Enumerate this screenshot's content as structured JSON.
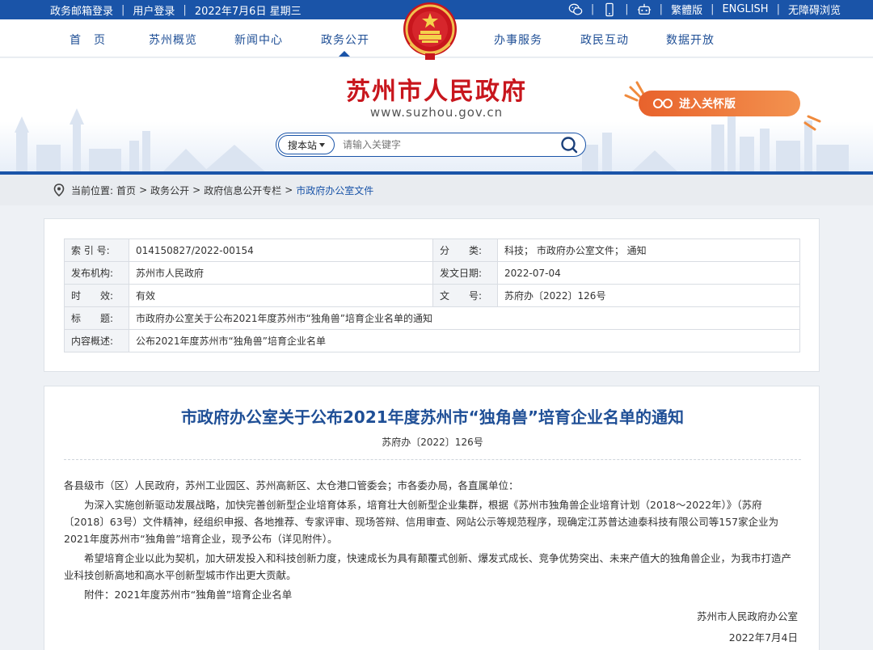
{
  "topbar": {
    "links": [
      "政务邮箱登录",
      "用户登录"
    ],
    "date": "2022年7月6日 星期三",
    "right_links": [
      "繁體版",
      "ENGLISH",
      "无障碍浏览"
    ],
    "icons": [
      "wechat-icon",
      "mobile-icon",
      "robot-icon"
    ]
  },
  "nav": {
    "items": [
      "首　页",
      "苏州概览",
      "新闻中心",
      "政务公开",
      "办事服务",
      "政民互动",
      "数据开放"
    ],
    "active": "政务公开"
  },
  "header": {
    "title": "苏州市人民政府",
    "url": "www.suzhou.gov.cn",
    "care_button": "进入关怀版"
  },
  "search": {
    "scope": "搜本站",
    "placeholder": "请输入关键字"
  },
  "breadcrumb": {
    "prefix": "当前位置:",
    "items": [
      "首页",
      "政务公开",
      "政府信息公开专栏",
      "市政府办公室文件"
    ],
    "sep": ">"
  },
  "info": {
    "index_label": "索 引 号:",
    "index_value": "014150827/2022-00154",
    "category_label": "分　　类:",
    "category_value": "科技； 市政府办公室文件； 通知",
    "publisher_label": "发布机构:",
    "publisher_value": "苏州市人民政府",
    "date_label": "发文日期:",
    "date_value": "2022-07-04",
    "validity_label": "时　　效:",
    "validity_value": "有效",
    "docno_label": "文　　号:",
    "docno_value": "苏府办〔2022〕126号",
    "title_label": "标　　题:",
    "title_value": "市政府办公室关于公布2021年度苏州市“独角兽”培育企业名单的通知",
    "summary_label": "内容概述:",
    "summary_value": "公布2021年度苏州市“独角兽”培育企业名单"
  },
  "article": {
    "title": "市政府办公室关于公布2021年度苏州市“独角兽”培育企业名单的通知",
    "doc_no": "苏府办〔2022〕126号",
    "greeting": "各县级市（区）人民政府，苏州工业园区、苏州高新区、太仓港口管委会；市各委办局，各直属单位：",
    "para1": "为深入实施创新驱动发展战略，加快完善创新型企业培育体系，培育壮大创新型企业集群，根据《苏州市独角兽企业培育计划（2018～2022年）》（苏府〔2018〕63号）文件精神，经组织申报、各地推荐、专家评审、现场答辩、信用审查、网站公示等规范程序，现确定江苏普达迪泰科技有限公司等157家企业为2021年度苏州市“独角兽”培育企业，现予公布（详见附件）。",
    "para2": "希望培育企业以此为契机，加大研发投入和科技创新力度，快速成长为具有颠覆式创新、爆发式成长、竞争优势突出、未来产值大的独角兽企业，为我市打造产业科技创新高地和高水平创新型城市作出更大贡献。",
    "attachment": "附件：2021年度苏州市“独角兽”培育企业名单",
    "signer": "苏州市人民政府办公室",
    "sign_date": "2022年7月4日"
  },
  "colors": {
    "primary_blue": "#1a54a8",
    "title_red": "#c8161d",
    "care_orange": "#e8622c"
  }
}
